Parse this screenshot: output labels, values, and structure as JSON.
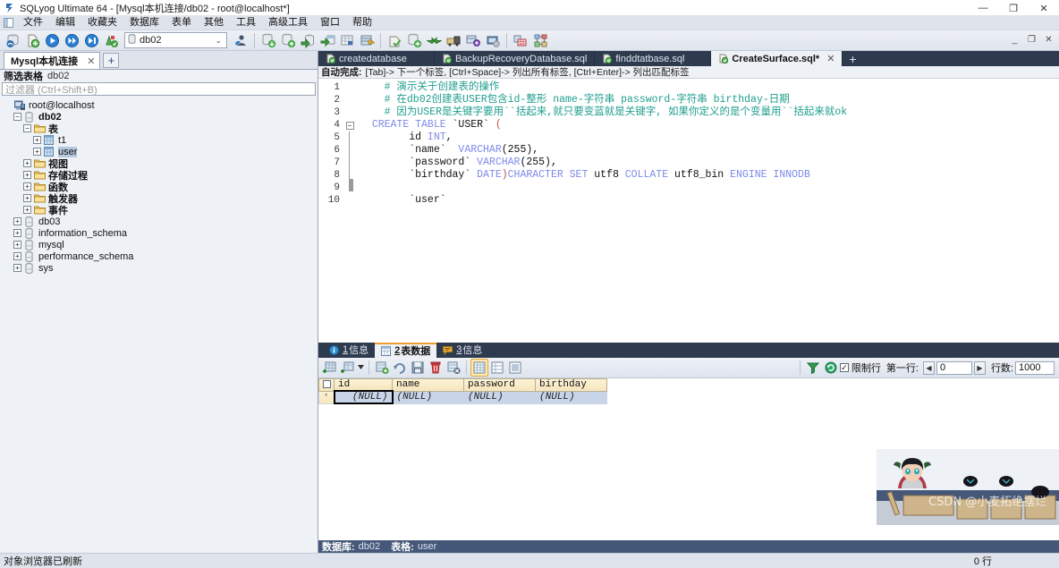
{
  "window": {
    "title": "SQLyog Ultimate 64 - [Mysql本机连接/db02 - root@localhost*]",
    "minimize": "—",
    "maximize": "❐",
    "close": "✕",
    "mdi_minimize": "_",
    "mdi_restore": "❐",
    "mdi_close": "✕"
  },
  "menubar": {
    "items": [
      {
        "label": "文件"
      },
      {
        "label": "编辑"
      },
      {
        "label": "收藏夹"
      },
      {
        "label": "数据库"
      },
      {
        "label": "表单"
      },
      {
        "label": "其他"
      },
      {
        "label": "工具"
      },
      {
        "label": "高级工具"
      },
      {
        "label": "窗口"
      },
      {
        "label": "帮助"
      }
    ]
  },
  "toolbar": {
    "db_combo_value": "db02",
    "db_combo_caret": "⌄"
  },
  "sidebar": {
    "connection_tab": {
      "label": "Mysql本机连接",
      "close": "✕"
    },
    "add_tab": "+",
    "filter_header_label": "筛选表格",
    "filter_header_db": "db02",
    "filter_placeholder": "过滤器 (Ctrl+Shift+B)",
    "tree": [
      {
        "label": "root@localhost",
        "level": 0,
        "expander": "",
        "icon": "server-icon",
        "bold": false,
        "selected": false
      },
      {
        "label": "db02",
        "level": 1,
        "expander": "−",
        "icon": "database-icon",
        "bold": true,
        "selected": false
      },
      {
        "label": "表",
        "level": 2,
        "expander": "−",
        "icon": "folder-icon",
        "bold": true,
        "selected": false
      },
      {
        "label": "t1",
        "level": 3,
        "expander": "+",
        "icon": "table-icon",
        "bold": false,
        "selected": false
      },
      {
        "label": "user",
        "level": 3,
        "expander": "+",
        "icon": "table-icon",
        "bold": false,
        "selected": true
      },
      {
        "label": "视图",
        "level": 2,
        "expander": "+",
        "icon": "folder-icon",
        "bold": true,
        "selected": false
      },
      {
        "label": "存储过程",
        "level": 2,
        "expander": "+",
        "icon": "folder-icon",
        "bold": true,
        "selected": false
      },
      {
        "label": "函数",
        "level": 2,
        "expander": "+",
        "icon": "folder-icon",
        "bold": true,
        "selected": false
      },
      {
        "label": "触发器",
        "level": 2,
        "expander": "+",
        "icon": "folder-icon",
        "bold": true,
        "selected": false
      },
      {
        "label": "事件",
        "level": 2,
        "expander": "+",
        "icon": "folder-icon",
        "bold": true,
        "selected": false
      },
      {
        "label": "db03",
        "level": 1,
        "expander": "+",
        "icon": "database-icon",
        "bold": false,
        "selected": false
      },
      {
        "label": "information_schema",
        "level": 1,
        "expander": "+",
        "icon": "database-icon",
        "bold": false,
        "selected": false
      },
      {
        "label": "mysql",
        "level": 1,
        "expander": "+",
        "icon": "database-icon",
        "bold": false,
        "selected": false
      },
      {
        "label": "performance_schema",
        "level": 1,
        "expander": "+",
        "icon": "database-icon",
        "bold": false,
        "selected": false
      },
      {
        "label": "sys",
        "level": 1,
        "expander": "+",
        "icon": "database-icon",
        "bold": false,
        "selected": false
      }
    ]
  },
  "editor": {
    "tabs": [
      {
        "label": "createdatabase",
        "active": false
      },
      {
        "label": "BackupRecoveryDatabase.sql",
        "active": false
      },
      {
        "label": "finddtatbase.sql",
        "active": false
      },
      {
        "label": "CreateSurface.sql*",
        "active": true,
        "close": "✕"
      }
    ],
    "add_tab": "+",
    "autocomplete_hint_label": "自动完成:",
    "autocomplete_hint_text": "[Tab]-> 下一个标签,  [Ctrl+Space]-> 列出所有标签,  [Ctrl+Enter]-> 列出匹配标签",
    "line_numbers": [
      "1",
      "2",
      "3",
      "4",
      "5",
      "6",
      "7",
      "8",
      "9",
      "10"
    ],
    "lines": [
      {
        "n": 1,
        "segments": [
          {
            "t": "    # 演示关于创建表的操作",
            "c": "comment"
          }
        ]
      },
      {
        "n": 2,
        "segments": [
          {
            "t": "    # 在db02创建表USER包含id-整形 name-字符串 password-字符串 birthday-日期",
            "c": "comment"
          }
        ]
      },
      {
        "n": 3,
        "segments": [
          {
            "t": "    # 因为USER是关键字要用``括起来,就只要变蓝就是关键字, 如果你定义的是个变量用``括起来就ok",
            "c": "comment"
          }
        ]
      },
      {
        "n": 4,
        "segments": [
          {
            "t": "  ",
            "c": "plain"
          },
          {
            "t": "CREATE TABLE ",
            "c": "kw"
          },
          {
            "t": "`USER`",
            "c": "plain"
          },
          {
            "t": " (",
            "c": "paren"
          }
        ]
      },
      {
        "n": 5,
        "segments": [
          {
            "t": "        id ",
            "c": "plain"
          },
          {
            "t": "INT",
            "c": "kw"
          },
          {
            "t": ",",
            "c": "plain"
          }
        ]
      },
      {
        "n": 6,
        "segments": [
          {
            "t": "        `name`  ",
            "c": "plain"
          },
          {
            "t": "VARCHAR",
            "c": "kw"
          },
          {
            "t": "(255),",
            "c": "plain"
          }
        ]
      },
      {
        "n": 7,
        "segments": [
          {
            "t": "        `password` ",
            "c": "plain"
          },
          {
            "t": "VARCHAR",
            "c": "kw"
          },
          {
            "t": "(255),",
            "c": "plain"
          }
        ]
      },
      {
        "n": 8,
        "segments": [
          {
            "t": "        `birthday` ",
            "c": "plain"
          },
          {
            "t": "DATE",
            "c": "kw"
          },
          {
            "t": ")",
            "c": "paren"
          },
          {
            "t": "CHARACTER SET ",
            "c": "kw"
          },
          {
            "t": "utf8 ",
            "c": "plain"
          },
          {
            "t": "COLLATE ",
            "c": "kw"
          },
          {
            "t": "utf8_bin ",
            "c": "plain"
          },
          {
            "t": "ENGINE INNODB",
            "c": "kw"
          }
        ]
      },
      {
        "n": 9,
        "segments": [
          {
            "t": "",
            "c": "plain"
          }
        ]
      },
      {
        "n": 10,
        "segments": [
          {
            "t": "        `user`",
            "c": "plain"
          }
        ]
      }
    ]
  },
  "results": {
    "tabs": [
      {
        "num": "1",
        "label": "信息",
        "icon": "info-icon",
        "active": false
      },
      {
        "num": "2",
        "label": "表数据",
        "icon": "grid-icon",
        "active": true
      },
      {
        "num": "3",
        "label": "信息",
        "icon": "message-icon",
        "active": false
      }
    ],
    "limit_checkbox_checked": true,
    "limit_checkbox_mark": "✓",
    "limit_label": "限制行",
    "first_row_label": "第一行:",
    "first_row_value": "0",
    "prev_arrow": "◀",
    "next_arrow": "▶",
    "rowcount_label": "行数:",
    "rowcount_value": "1000",
    "grid": {
      "columns": [
        "id",
        "name",
        "password",
        "birthday"
      ],
      "rows": [
        {
          "marker": "*",
          "cells": [
            "(NULL)",
            "(NULL)",
            "(NULL)",
            "(NULL)"
          ]
        }
      ]
    },
    "status_db_label": "数据库:",
    "status_db_value": "db02",
    "status_table_label": "表格:",
    "status_table_value": "user",
    "row_count_text": "0 行"
  },
  "statusbar": {
    "message": "对象浏览器已刷新"
  },
  "watermark": {
    "text": "CSDN @小麦拓绝摆烂"
  }
}
